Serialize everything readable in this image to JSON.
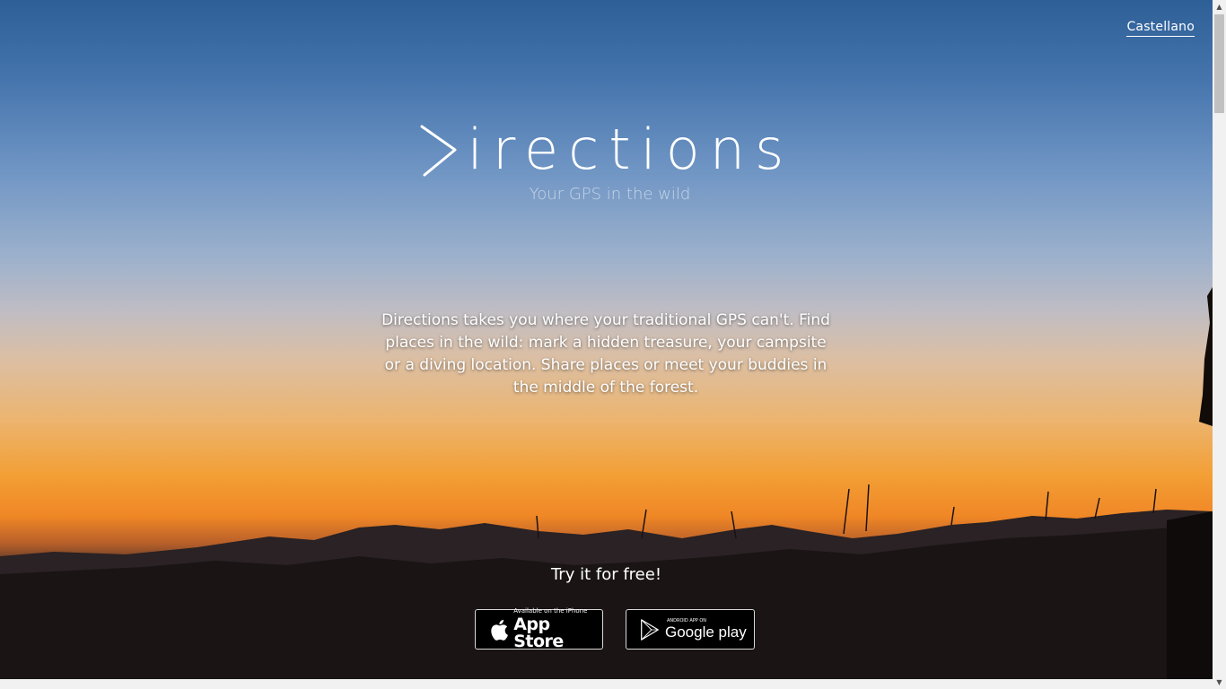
{
  "header": {
    "language_link": "Castellano"
  },
  "hero": {
    "logo_text": "irections",
    "tagline": "Your GPS in the wild",
    "description": "Directions takes you where your traditional GPS can't. Find places in the wild: mark a hidden treasure, your campsite or a diving location. Share places or meet your buddies in the middle of the forest.",
    "cta": "Try it for free!"
  },
  "stores": {
    "appstore_small": "Available on the iPhone",
    "appstore_big": "App Store",
    "appstore_icon": "apple-icon",
    "gplay_small": "ANDROID APP ON",
    "gplay_big": "Google play",
    "gplay_icon": "play-icon"
  },
  "colors": {
    "sky_top": "#2e5f97",
    "sunset_orange": "#f39f35",
    "ground": "#0e0b0b"
  }
}
